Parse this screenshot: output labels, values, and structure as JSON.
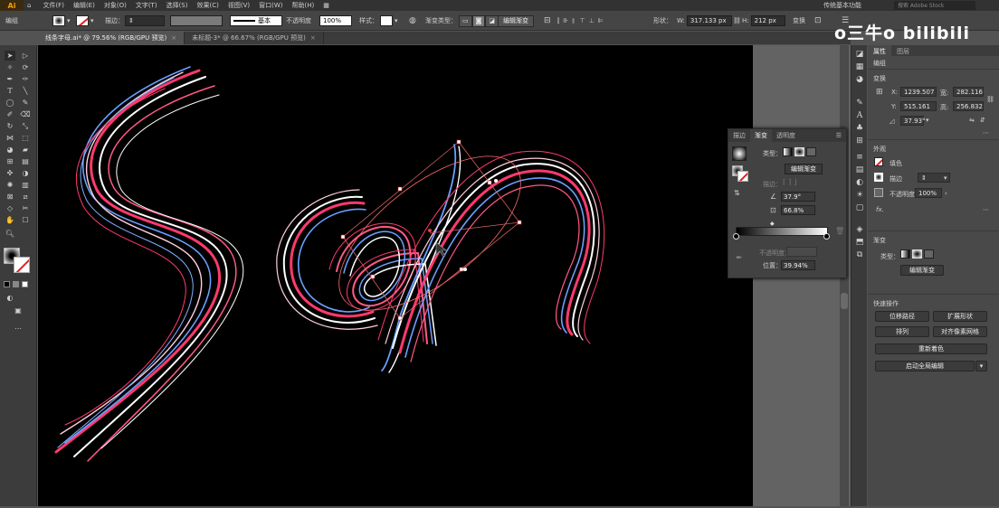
{
  "app": {
    "logo": "Ai"
  },
  "menu": [
    "文件(F)",
    "编辑(E)",
    "对象(O)",
    "文字(T)",
    "选择(S)",
    "效果(C)",
    "视图(V)",
    "窗口(W)",
    "帮助(H)"
  ],
  "workspace": "传统基本功能",
  "search_placeholder": "搜索 Adobe Stock",
  "control": {
    "object_type": "编组",
    "stroke_label": "描边：",
    "stroke_style": "基本",
    "opacity_label": "不透明度",
    "opacity_value": "100%",
    "style_label": "样式：",
    "gradient_type_label": "渐变类型：",
    "edit_gradient": "编辑渐变",
    "shape_label": "形状：",
    "w_value": "317.133 px",
    "h_value": "212 px",
    "transform_label": "变换"
  },
  "tabs": [
    {
      "label": "线条字母.ai* @ 79.56% (RGB/GPU 预览)",
      "active": true
    },
    {
      "label": "未标题-3* @ 66.67% (RGB/GPU 预览)",
      "active": false
    }
  ],
  "gradient_panel": {
    "tabs": [
      "描边",
      "渐变",
      "透明度"
    ],
    "type_label": "类型：",
    "edit_gradient": "编辑渐变",
    "stroke_label": "描边：",
    "angle": "37.9°",
    "aspect": "66.8%",
    "opacity_label": "不透明度：",
    "location_label": "位置：",
    "location_value": "39.94%"
  },
  "properties": {
    "tabs": [
      "属性",
      "图层"
    ],
    "object_type": "编组",
    "transform_title": "变换",
    "x_value": "1239.507",
    "y_value": "515.161",
    "w_value": "282.116",
    "h_value": "256.832",
    "angle_value": "37.93°",
    "appearance_title": "外观",
    "fill_label": "填色",
    "stroke_label": "描边",
    "opacity_label": "不透明度",
    "opacity_value": "100%",
    "fx_label": "fx.",
    "gradient_title": "渐变",
    "gradient_type_label": "类型：",
    "edit_gradient": "编辑渐变",
    "quick_title": "快速操作",
    "quick_buttons": [
      "位移路径",
      "扩展形状",
      "排列",
      "对齐像素网格",
      "重新着色",
      "启动全局编辑"
    ]
  },
  "watermark": "o三牛o bilibili",
  "colors": {
    "pink": "#ff3a6e",
    "blue": "#6aa0ff",
    "white": "#ffffff"
  }
}
